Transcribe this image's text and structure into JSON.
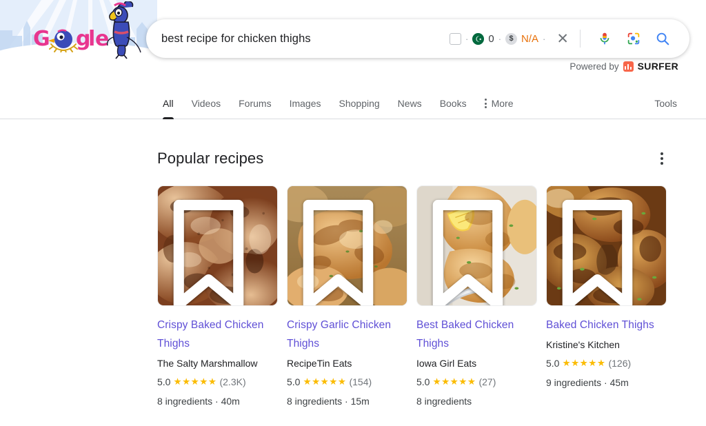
{
  "doodle": {
    "logo_text": "Google",
    "alt": "google-doodle-bird"
  },
  "search": {
    "query": "best recipe for chicken thighs",
    "placeholder": "Search",
    "extension": {
      "checkbox_checked": false,
      "country_code": "PK",
      "country_value": "0",
      "currency_symbol": "$",
      "currency_value": "N/A",
      "separator": "·",
      "clear_label": "✕"
    },
    "mic_label": "Search by voice",
    "lens_label": "Search by image",
    "search_label": "Google Search"
  },
  "powered_by": {
    "prefix": "Powered by",
    "brand": "SURFER",
    "brand_color": "#f8664a"
  },
  "nav": {
    "tabs": [
      {
        "label": "All",
        "active": true
      },
      {
        "label": "Videos",
        "active": false
      },
      {
        "label": "Forums",
        "active": false
      },
      {
        "label": "Images",
        "active": false
      },
      {
        "label": "Shopping",
        "active": false
      },
      {
        "label": "News",
        "active": false
      },
      {
        "label": "Books",
        "active": false
      }
    ],
    "more_label": "More",
    "tools_label": "Tools"
  },
  "main": {
    "section_title": "Popular recipes",
    "cards": [
      {
        "title": "Crispy Baked Chicken Thighs",
        "source": "The Salty Marshmallow",
        "rating": "5.0",
        "stars": "★★★★★",
        "rating_count": "(2.3K)",
        "meta": "8 ingredients · 40m",
        "image_alt": "crispy-baked-chicken-thighs-photo",
        "bookmark_label": "Save recipe"
      },
      {
        "title": "Crispy Garlic Chicken Thighs",
        "source": "RecipeTin Eats",
        "rating": "5.0",
        "stars": "★★★★★",
        "rating_count": "(154)",
        "meta": "8 ingredients · 15m",
        "image_alt": "crispy-garlic-chicken-thighs-photo",
        "bookmark_label": "Save recipe"
      },
      {
        "title": "Best Baked Chicken Thighs",
        "source": "Iowa Girl Eats",
        "rating": "5.0",
        "stars": "★★★★★",
        "rating_count": "(27)",
        "meta": "8 ingredients",
        "image_alt": "best-baked-chicken-thighs-photo",
        "bookmark_label": "Save recipe"
      },
      {
        "title": "Baked Chicken Thighs",
        "source": "Kristine's Kitchen",
        "rating": "5.0",
        "stars": "★★★★★",
        "rating_count": "(126)",
        "meta": "9 ingredients · 45m",
        "image_alt": "baked-chicken-thighs-photo",
        "bookmark_label": "Save recipe"
      }
    ]
  },
  "colors": {
    "link": "#5f4fd6",
    "star": "#fbbc04",
    "text": "#202124",
    "muted": "#5f6368"
  }
}
